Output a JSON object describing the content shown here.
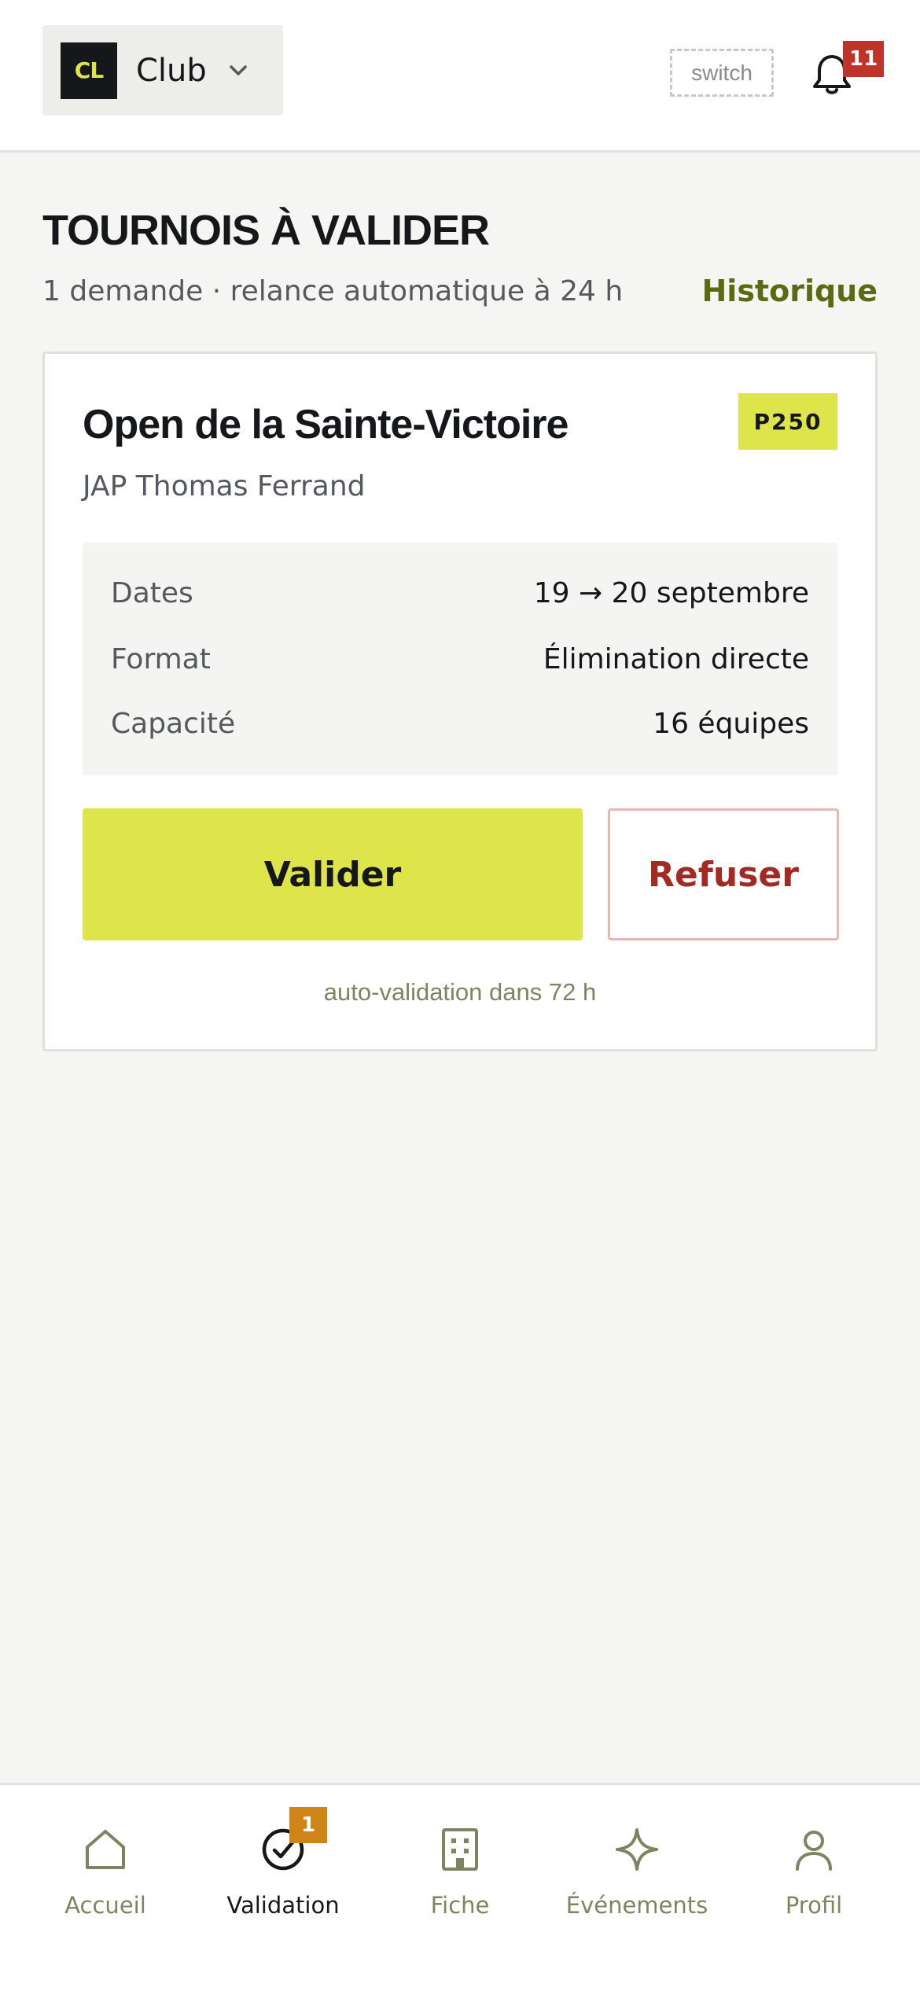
{
  "header": {
    "club_logo_text": "CL",
    "club_name": "Club",
    "switch_label": "switch",
    "notification_count": "11"
  },
  "section": {
    "title": "TOURNOIS À VALIDER",
    "subtitle": "1 demande · relance automatique à 24 h",
    "history_link": "Historique"
  },
  "card": {
    "title": "Open de la Sainte-Victoire",
    "level": "P250",
    "organizer": "JAP Thomas Ferrand",
    "details": [
      {
        "label": "Dates",
        "value": "19 → 20 septembre"
      },
      {
        "label": "Format",
        "value": "Élimination directe"
      },
      {
        "label": "Capacité",
        "value": "16 équipes"
      }
    ],
    "validate_label": "Valider",
    "refuse_label": "Refuser",
    "auto_note": "auto-validation dans 72 h"
  },
  "nav": {
    "items": [
      {
        "label": "Accueil",
        "icon": "home-icon"
      },
      {
        "label": "Validation",
        "icon": "check-circle-icon",
        "badge": "1",
        "active": true
      },
      {
        "label": "Fiche",
        "icon": "building-icon"
      },
      {
        "label": "Événements",
        "icon": "sparkle-icon"
      },
      {
        "label": "Profil",
        "icon": "user-icon"
      }
    ]
  },
  "colors": {
    "accent": "#dde54a",
    "brand_dark": "#15171a",
    "link_green": "#5b6b12",
    "danger": "#a32a22",
    "notification": "#c0332a",
    "nav_badge": "#cf8418"
  }
}
